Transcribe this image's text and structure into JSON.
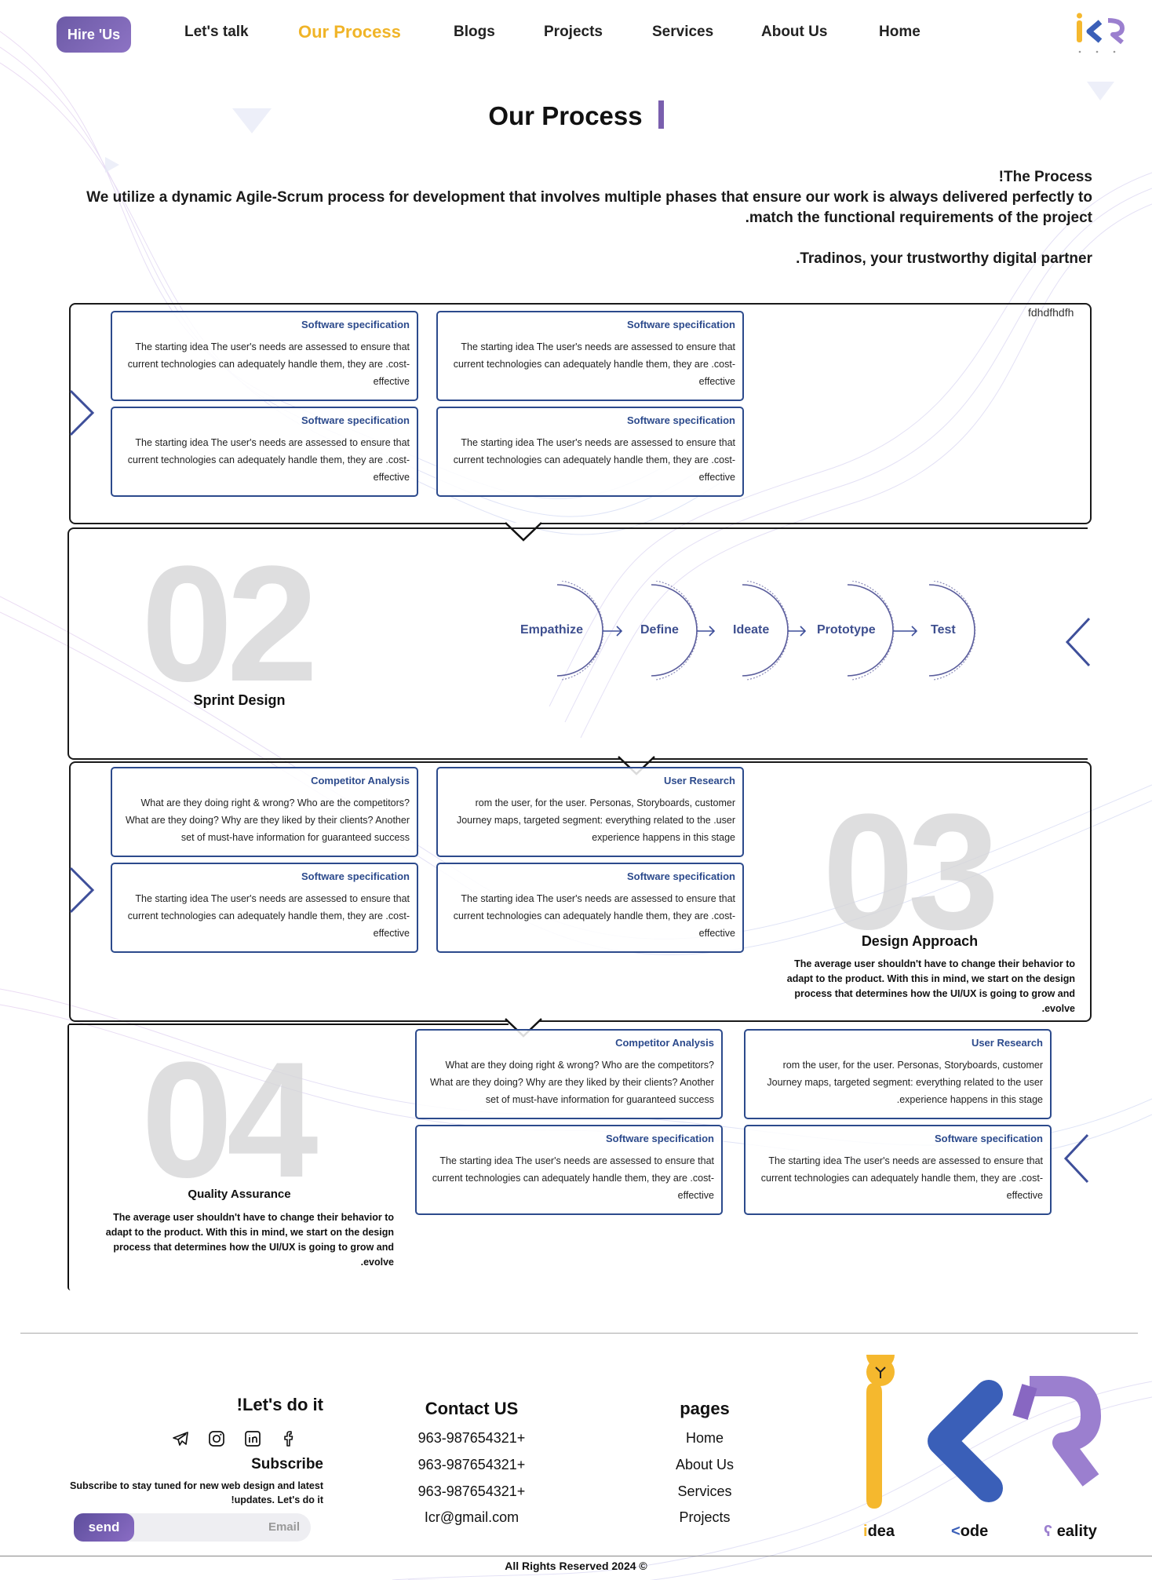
{
  "header": {
    "hire_button": "Hire 'Us",
    "nav": [
      "Let's talk",
      "Our Process",
      "Blogs",
      "Projects",
      "Services",
      "About Us",
      "Home"
    ],
    "active_nav": "Our Process",
    "logo_text": "iCR"
  },
  "page": {
    "title": "Our Process",
    "intro_heading": "!The Process",
    "intro_line1": "We utilize a dynamic Agile-Scrum process for development that involves multiple phases that ensure our work is always delivered perfectly to",
    "intro_line2": ".match the functional requirements of the project",
    "intro_tagline": ".Tradinos, your trustworthy digital partner"
  },
  "step1": {
    "stray_text": "fdhdfhdfh",
    "cards": [
      {
        "title": "Software specification",
        "text": "The starting idea The user's needs are assessed to ensure that current technologies can adequately handle them, they are .cost-effective"
      },
      {
        "title": "Software specification",
        "text": "The starting idea The user's needs are assessed to ensure that current technologies can adequately handle them, they are .cost-effective"
      },
      {
        "title": "Software specification",
        "text": "The starting idea The user's needs are assessed to ensure that current technologies can adequately handle them, they are .cost-effective"
      },
      {
        "title": "Software specification",
        "text": "The starting idea The user's needs are assessed to ensure that current technologies can adequately handle them, they are .cost-effective"
      }
    ]
  },
  "step2": {
    "number": "02",
    "title": "Sprint Design",
    "stages": [
      "Empathize",
      "Define",
      "Ideate",
      "Prototype",
      "Test"
    ]
  },
  "step3": {
    "number": "03",
    "title": "Design Approach",
    "description": "The average user shouldn't have to change their behavior to adapt to the product. With this in mind, we start on the design process that determines how the UI/UX is going to grow and .evolve",
    "cards": [
      {
        "title": "Competitor Analysis",
        "text": "What are they doing right & wrong? Who are the competitors? What are they doing? Why are they liked by their clients? Another set of must-have information for guaranteed success"
      },
      {
        "title": "User Research",
        "text": "rom the user, for the user. Personas, Storyboards, customer Journey maps, targeted segment: everything related to the .user experience happens in this stage"
      },
      {
        "title": "Software specification",
        "text": "The starting idea The user's needs are assessed to ensure that current technologies can adequately handle them, they are .cost-effective"
      },
      {
        "title": "Software specification",
        "text": "The starting idea The user's needs are assessed to ensure that current technologies can adequately handle them, they are .cost-effective"
      }
    ]
  },
  "step4": {
    "number": "04",
    "title": "Quality Assurance",
    "description": "The average user shouldn't have to change their behavior to adapt to the product. With this in mind, we start on the design process that determines how the UI/UX is going to grow and .evolve",
    "cards": [
      {
        "title": "Competitor Analysis",
        "text": "What are they doing right & wrong? Who are the competitors? What are they doing? Why are they liked by their clients? Another set of must-have information for guaranteed success"
      },
      {
        "title": "User Research",
        "text": "rom the user, for the user. Personas, Storyboards, customer Journey maps, targeted segment: everything related to the user .experience happens in this stage"
      },
      {
        "title": "Software specification",
        "text": "The starting idea The user's needs are assessed to ensure that current technologies can adequately handle them, they are .cost-effective"
      },
      {
        "title": "Software specification",
        "text": "The starting idea The user's needs are assessed to ensure that current technologies can adequately handle them, they are .cost-effective"
      }
    ]
  },
  "footer": {
    "lets_do_it": "!Let's do it",
    "subscribe_title": "Subscribe",
    "subscribe_text_1": "Subscribe to stay tuned for new web design and latest",
    "subscribe_text_2": "!updates. Let's do it",
    "send_label": "send",
    "email_placeholder": "Email",
    "contact_title": "Contact US",
    "phones": [
      "963-987654321+",
      "963-987654321+",
      "963-987654321+"
    ],
    "email": "Icr@gmail.com",
    "pages_title": "pages",
    "pages": [
      "Home",
      "About Us",
      "Services",
      "Projects"
    ],
    "logo_words": [
      "dea",
      "ode",
      "eality"
    ],
    "copyright": "All Rights Reserved 2024 ©"
  },
  "colors": {
    "accent": "#f0b428",
    "brand_purple": "#7a5fae",
    "card_border": "#2c4a8c",
    "logo_yellow": "#f5b82e",
    "logo_blue": "#3a5fb8",
    "logo_violet": "#9b7fcf"
  },
  "icons": [
    "telegram-icon",
    "instagram-icon",
    "linkedin-icon",
    "facebook-icon",
    "chevron-right-icon",
    "chevron-left-icon",
    "chevron-down-icon"
  ]
}
